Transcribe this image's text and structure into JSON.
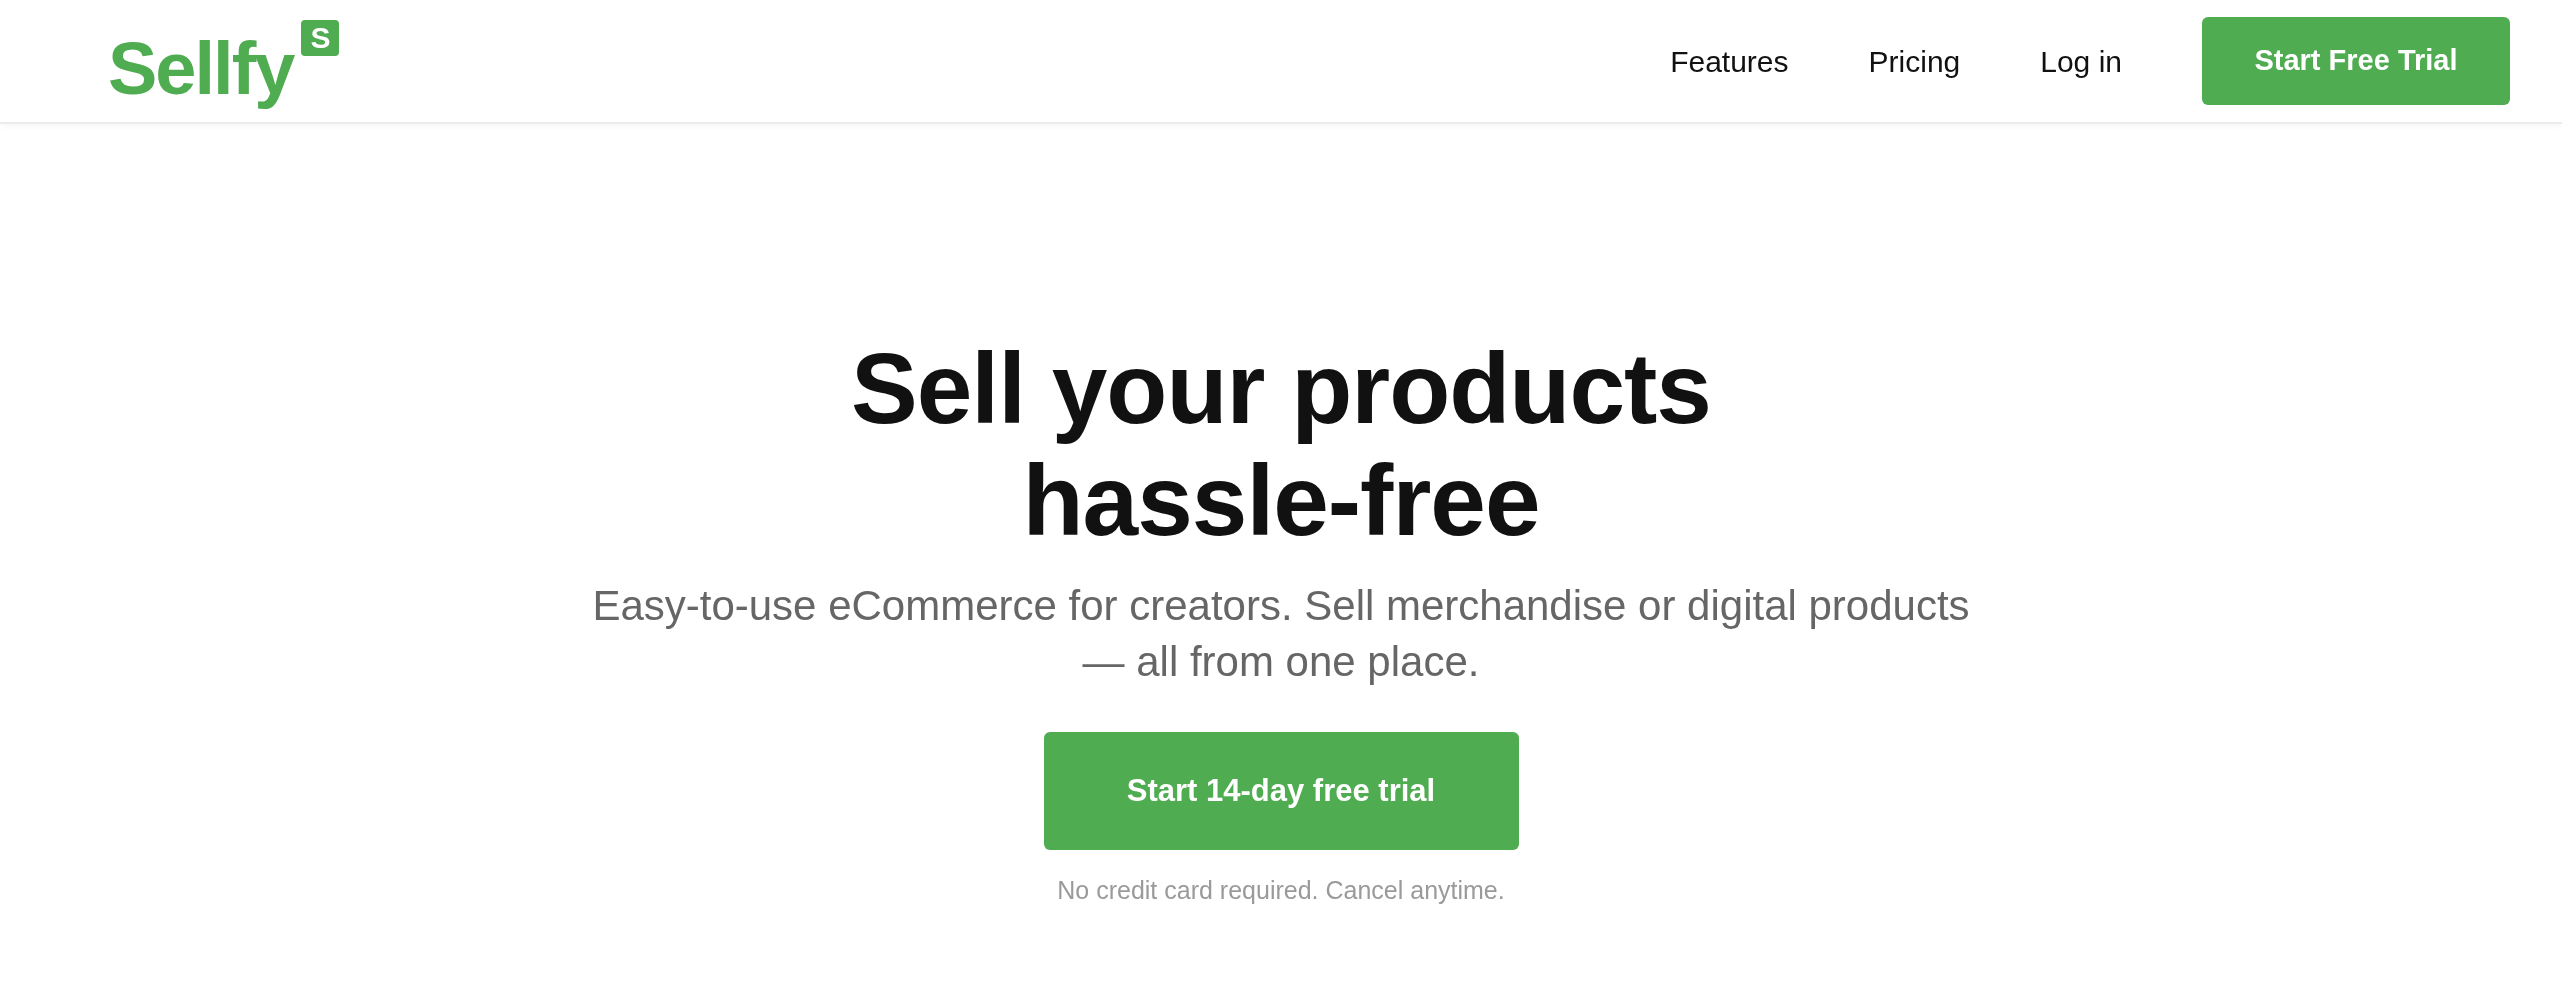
{
  "logo": {
    "text": "Sellfy",
    "badge": "S"
  },
  "nav": {
    "links": [
      "Features",
      "Pricing",
      "Log in"
    ],
    "cta": "Start Free Trial"
  },
  "hero": {
    "title_lines": [
      "Sell your products",
      "hassle-free"
    ],
    "subtitle": "Easy-to-use eCommerce for creators. Sell merchandise or digital products — all from one place.",
    "button": "Start 14-day free trial",
    "note": "No credit card required. Cancel anytime."
  }
}
